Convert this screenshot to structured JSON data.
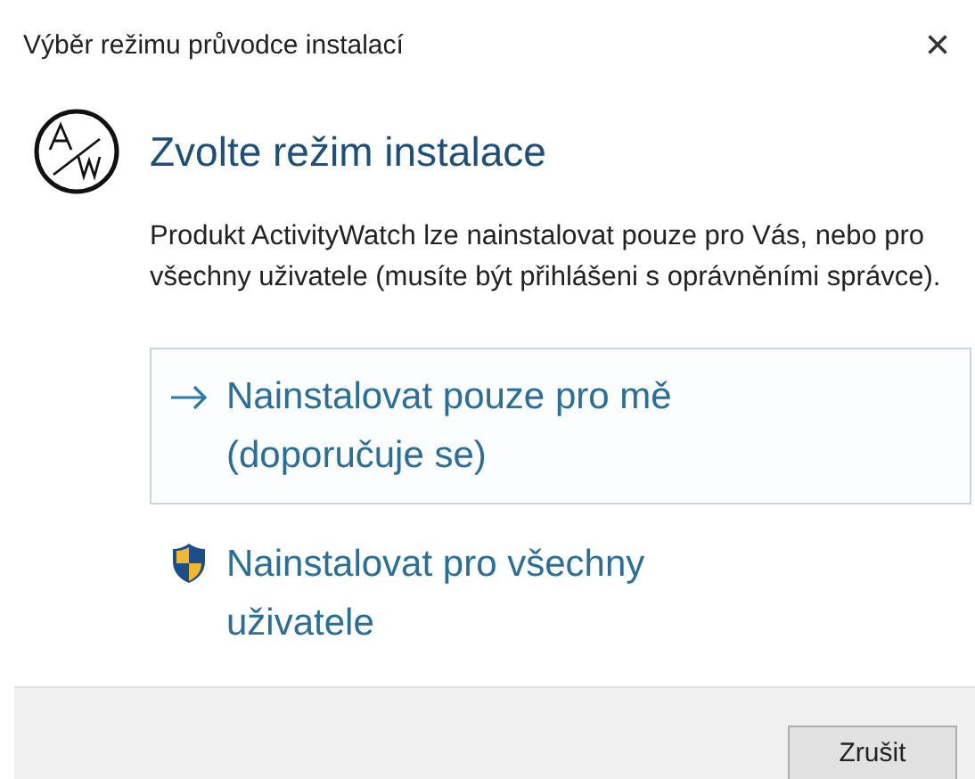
{
  "window": {
    "title": "Výběr režimu průvodce instalací",
    "close": "×"
  },
  "heading": "Zvolte režim instalace",
  "description": "Produkt ActivityWatch lze nainstalovat pouze pro Vás, nebo pro všechny uživatele (musíte být přihlášeni s oprávněními správce).",
  "options": [
    {
      "kind": "arrow",
      "label": "Nainstalovat pouze pro mě (doporučuje se)",
      "selected": true
    },
    {
      "kind": "shield",
      "label": "Nainstalovat pro všechny uživatele",
      "selected": false
    }
  ],
  "buttons": [
    "Zrušit"
  ]
}
